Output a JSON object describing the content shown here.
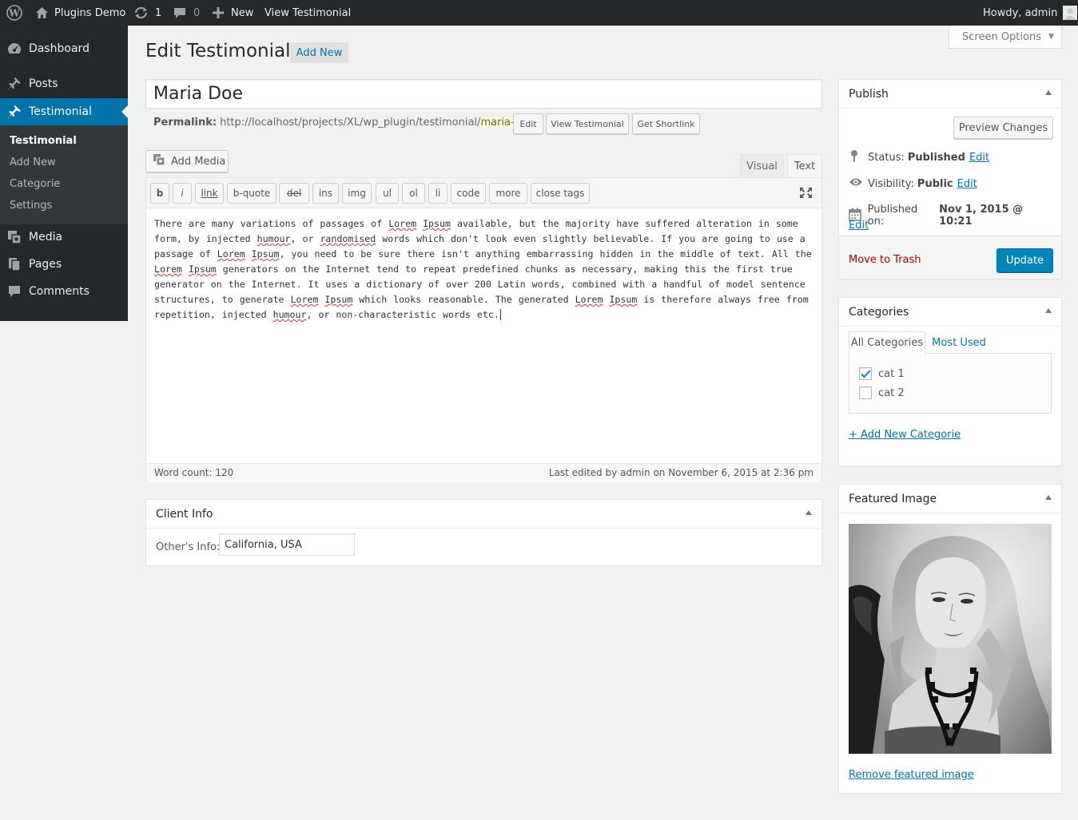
{
  "adminbar": {
    "site_name": "Plugins Demo",
    "updates_count": "1",
    "comments_count": "0",
    "new_label": "New",
    "view_label": "View Testimonial",
    "howdy": "Howdy, admin"
  },
  "sidebar": {
    "dashboard": "Dashboard",
    "posts": "Posts",
    "testimonial": "Testimonial",
    "submenu": [
      "Testimonial",
      "Add New",
      "Categorie",
      "Settings"
    ],
    "media": "Media",
    "pages": "Pages",
    "comments": "Comments"
  },
  "header": {
    "title": "Edit Testimonial",
    "add_new": "Add New",
    "screen_options": "Screen Options"
  },
  "post": {
    "title": "Maria Doe",
    "permalink_label": "Permalink:",
    "permalink_base": "http://localhost/projects/XL/wp_plugin/testimonial/",
    "permalink_slug": "maria-doe",
    "permalink_trail": "/",
    "edit_btn": "Edit",
    "view_btn": "View Testimonial",
    "shortlink_btn": "Get Shortlink"
  },
  "editor": {
    "add_media": "Add Media",
    "tab_visual": "Visual",
    "tab_text": "Text",
    "quicktags": [
      "b",
      "i",
      "link",
      "b-quote",
      "del",
      "ins",
      "img",
      "ul",
      "ol",
      "li",
      "code",
      "more",
      "close tags"
    ],
    "content": {
      "seg1": "There are many variations of passages of ",
      "seg2": "Lorem",
      "seg3": " ",
      "seg4": "Ipsum",
      "seg5": " available, but the majority have suffered alteration in some form, by injected ",
      "seg6": "humour",
      "seg7": ", or ",
      "seg8": "randomised",
      "seg9": " words which don't look even slightly believable. If you are going to use a passage of ",
      "seg10": "Lorem",
      "seg11": " ",
      "seg12": "Ipsum",
      "seg13": ", you need to be sure there isn't anything embarrassing hidden in the middle of text. All the ",
      "seg14": "Lorem",
      "seg15": " ",
      "seg16": "Ipsum",
      "seg17": " generators on the Internet tend to repeat predefined chunks as necessary, making this the first true generator on the Internet. It uses a dictionary of over 200 Latin words, combined with a handful of model sentence structures, to generate ",
      "seg18": "Lorem",
      "seg19": " ",
      "seg20": "Ipsum",
      "seg21": " which looks reasonable. The generated ",
      "seg22": "Lorem",
      "seg23": " ",
      "seg24": "Ipsum",
      "seg25": " is therefore always free from repetition, injected ",
      "seg26": "humour",
      "seg27": ", or non-characteristic words etc."
    },
    "word_count": "Word count: 120",
    "last_edited": "Last edited by admin on November 6, 2015 at 2:36 pm"
  },
  "client_info": {
    "title": "Client Info",
    "label": "Other's Info:",
    "value": "California, USA"
  },
  "publish": {
    "title": "Publish",
    "preview": "Preview Changes",
    "status_label": "Status:",
    "status_value": "Published",
    "visibility_label": "Visibility:",
    "visibility_value": "Public",
    "published_label": "Published on:",
    "published_value": "Nov 1, 2015 @ 10:21",
    "edit": "Edit",
    "trash": "Move to Trash",
    "update": "Update"
  },
  "categories": {
    "title": "Categories",
    "tab_all": "All Categories",
    "tab_most_used": "Most Used",
    "items": [
      {
        "label": "cat 1",
        "checked": true
      },
      {
        "label": "cat 2",
        "checked": false
      }
    ],
    "add_new": "+ Add New Categorie"
  },
  "featured_image": {
    "title": "Featured Image",
    "remove": "Remove featured image"
  },
  "colors": {
    "adminbar_bg": "#23282d",
    "accent": "#0073aa",
    "update_button": "#0085ba",
    "trash": "#a00"
  },
  "icons": [
    "wordpress-logo-icon",
    "home-icon",
    "updates-icon",
    "comment-icon",
    "plus-icon",
    "avatar-icon",
    "dashboard-icon",
    "pin-icon",
    "media-icon",
    "pages-icon",
    "comments-icon",
    "fullscreen-icon",
    "location-pin-icon",
    "eye-icon",
    "calendar-icon",
    "checkmark-icon"
  ]
}
